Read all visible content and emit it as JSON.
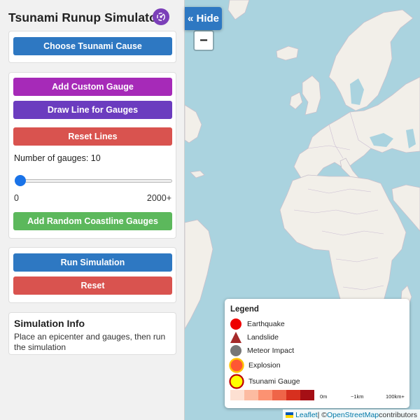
{
  "sidebar": {
    "title": "Tsunami Runup Simulator",
    "settings_icon": "radar-icon",
    "choose_cause_label": "Choose Tsunami Cause",
    "add_custom_gauge_label": "Add Custom Gauge",
    "draw_line_label": "Draw Line for Gauges",
    "reset_lines_label": "Reset Lines",
    "gauge_count_label": "Number of gauges: 10",
    "slider": {
      "min_label": "0",
      "max_label": "2000+",
      "value": 10
    },
    "add_random_label": "Add Random Coastline Gauges",
    "run_simulation_label": "Run Simulation",
    "reset_label": "Reset",
    "info": {
      "title": "Simulation Info",
      "text": "Place an epicenter and gauges, then run the simulation"
    }
  },
  "map_controls": {
    "hide_label": "« Hide",
    "zoom_out_label": "−"
  },
  "legend": {
    "title": "Legend",
    "items": [
      {
        "label": "Earthquake",
        "icon": "red-circle-icon",
        "color": "#ee0000"
      },
      {
        "label": "Landslide",
        "icon": "triangle-icon",
        "color": "#a52a2a"
      },
      {
        "label": "Meteor Impact",
        "icon": "gray-circle-icon",
        "color": "#777777"
      },
      {
        "label": "Explosion",
        "icon": "explosion-icon",
        "color": "#ff5733"
      },
      {
        "label": "Tsunami Gauge",
        "icon": "gauge-icon",
        "color": "#ffff00"
      }
    ],
    "ramp_colors": [
      "#fde0d2",
      "#fcbba1",
      "#fc9272",
      "#ef6548",
      "#d7301f",
      "#a50f15"
    ],
    "ramp_labels": [
      "0m",
      "~1km",
      "100km+"
    ]
  },
  "attribution": {
    "leaflet": "Leaflet",
    "separator": " | © ",
    "osm": "OpenStreetMap",
    "suffix": " contributors"
  },
  "colors": {
    "primary_blue": "#2e78c2",
    "magenta": "#a62ab8",
    "violet": "#6b3cbf",
    "danger_red": "#d9534f",
    "success_green": "#5cb85c",
    "ocean": "#aad3df",
    "land": "#f2efe9"
  }
}
